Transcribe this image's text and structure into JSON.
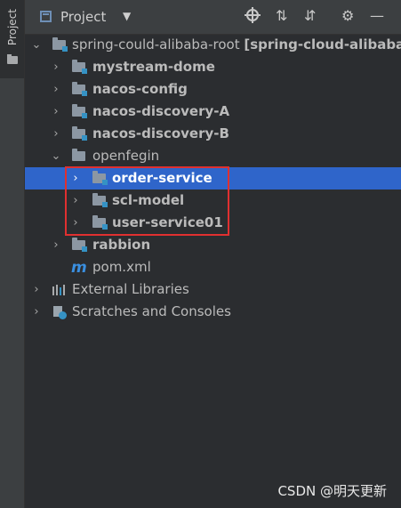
{
  "sidebar": {
    "tab_label": "Project"
  },
  "toolbar": {
    "title": "Project",
    "caret": "▼",
    "collapse_icon": "⇅",
    "expand_icon": "⇵",
    "settings_icon": "⚙",
    "hide_icon": "—"
  },
  "tree": {
    "root_label": "spring-could-alibaba-root",
    "root_bold_suffix": "[spring-cloud-alibaba-",
    "items": [
      {
        "label": "mystream-dome"
      },
      {
        "label": "nacos-config"
      },
      {
        "label": "nacos-discovery-A"
      },
      {
        "label": "nacos-discovery-B"
      },
      {
        "label": "openfegin"
      },
      {
        "label": "order-service"
      },
      {
        "label": "scl-model"
      },
      {
        "label": "user-service01"
      },
      {
        "label": "rabbion"
      },
      {
        "label": "pom.xml"
      },
      {
        "label": "External Libraries"
      },
      {
        "label": "Scratches and Consoles"
      }
    ]
  },
  "watermark": "CSDN @明天更新",
  "colors": {
    "selection": "#2f65ca",
    "highlight_box": "#e03030",
    "module_badge": "#3592c4"
  }
}
